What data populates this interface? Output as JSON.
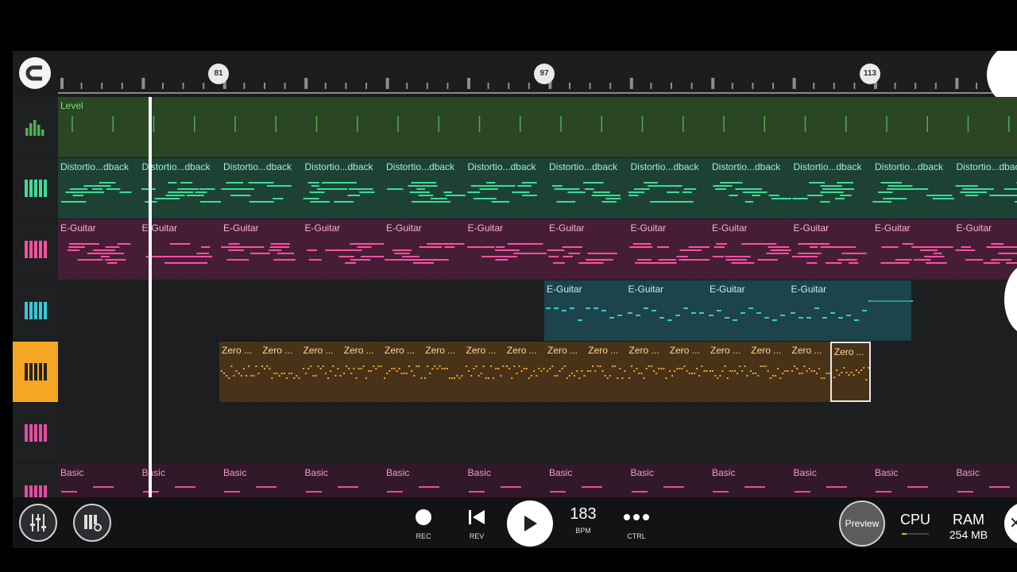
{
  "colors": {
    "level": "#4caf50",
    "distortion": "#3ddc97",
    "eguitar_pink": "#ff4fa3",
    "eguitar_teal": "#38c8d8",
    "zero": "#f0a630",
    "basic": "#e84aa0",
    "active_track": "#f5a623"
  },
  "timeline": {
    "markers": [
      "81",
      "97",
      "113"
    ]
  },
  "tracks": [
    {
      "icon": "level-meter-icon",
      "clips": [
        {
          "label": "Level"
        }
      ]
    },
    {
      "icon": "piano-keys-icon",
      "clips": [
        {
          "label": "Distortio...dback"
        },
        {
          "label": "Distortio...dback"
        },
        {
          "label": "Distortio...dback"
        },
        {
          "label": "Distortio...dback"
        },
        {
          "label": "Distortio...dback"
        },
        {
          "label": "Distortio...dback"
        },
        {
          "label": "Distortio...dback"
        },
        {
          "label": "Distortio...dback"
        },
        {
          "label": "Distortio...dback"
        },
        {
          "label": "Distortio...dback"
        },
        {
          "label": "Distortio...dback"
        },
        {
          "label": "Distortio...dback"
        }
      ]
    },
    {
      "icon": "piano-keys-icon",
      "clips": [
        {
          "label": "E-Guitar"
        },
        {
          "label": "E-Guitar"
        },
        {
          "label": "E-Guitar"
        },
        {
          "label": "E-Guitar"
        },
        {
          "label": "E-Guitar"
        },
        {
          "label": "E-Guitar"
        },
        {
          "label": "E-Guitar"
        },
        {
          "label": "E-Guitar"
        },
        {
          "label": "E-Guitar"
        },
        {
          "label": "E-Guitar"
        },
        {
          "label": "E-Guitar"
        },
        {
          "label": "E-Guitar"
        }
      ]
    },
    {
      "icon": "piano-keys-icon",
      "clips": [
        {
          "label": "E-Guitar"
        },
        {
          "label": "E-Guitar"
        },
        {
          "label": "E-Guitar"
        },
        {
          "label": "E-Guitar"
        }
      ]
    },
    {
      "icon": "piano-keys-icon",
      "active": true,
      "clips": [
        {
          "label": "Zero ..."
        },
        {
          "label": "Zero ..."
        },
        {
          "label": "Zero ..."
        },
        {
          "label": "Zero ..."
        },
        {
          "label": "Zero ..."
        },
        {
          "label": "Zero ..."
        },
        {
          "label": "Zero ..."
        },
        {
          "label": "Zero ..."
        },
        {
          "label": "Zero ..."
        },
        {
          "label": "Zero ..."
        },
        {
          "label": "Zero ..."
        },
        {
          "label": "Zero ..."
        },
        {
          "label": "Zero ..."
        },
        {
          "label": "Zero ..."
        },
        {
          "label": "Zero ..."
        },
        {
          "label": "Zero ..."
        }
      ]
    },
    {
      "icon": "piano-keys-icon",
      "clips": []
    },
    {
      "icon": "piano-keys-icon",
      "clips": [
        {
          "label": "Basic"
        },
        {
          "label": "Basic"
        },
        {
          "label": "Basic"
        },
        {
          "label": "Basic"
        },
        {
          "label": "Basic"
        },
        {
          "label": "Basic"
        },
        {
          "label": "Basic"
        },
        {
          "label": "Basic"
        },
        {
          "label": "Basic"
        },
        {
          "label": "Basic"
        },
        {
          "label": "Basic"
        },
        {
          "label": "Basic"
        }
      ]
    }
  ],
  "transport": {
    "rec_label": "REC",
    "rev_label": "REV",
    "bpm_value": "183",
    "bpm_label": "BPM",
    "ctrl_label": "CTRL",
    "preview_label": "Preview",
    "cpu_label": "CPU",
    "ram_label": "RAM",
    "ram_value": "254 MB"
  }
}
